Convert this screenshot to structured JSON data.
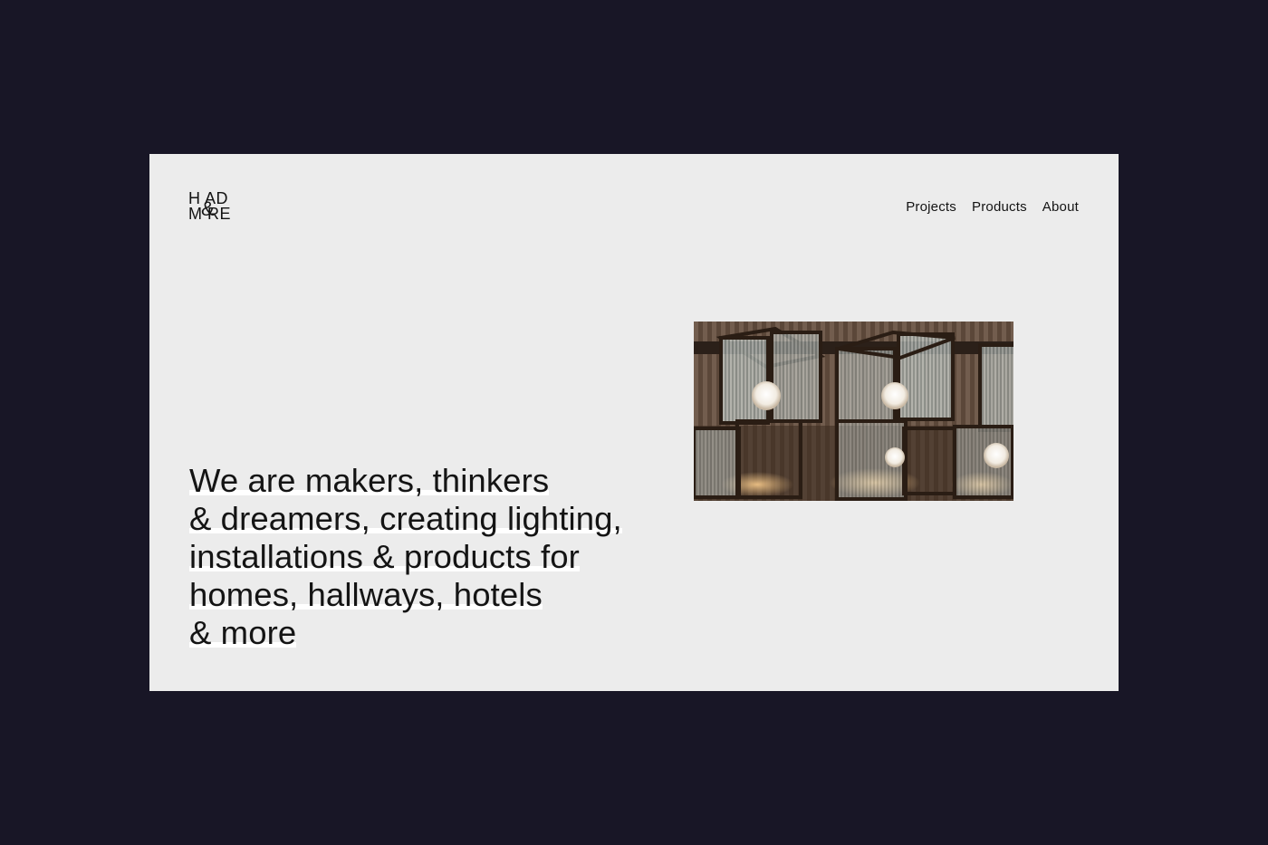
{
  "brand": {
    "logo_line1": "H AD",
    "logo_line2": "M RE",
    "logo_amp": "&",
    "logo_name": "Head & More"
  },
  "nav": [
    {
      "label": "Projects"
    },
    {
      "label": "Products"
    },
    {
      "label": "About"
    }
  ],
  "hero": {
    "lines": [
      "We are makers, thinkers",
      "& dreamers, creating lighting,",
      "installations & products for",
      "homes, hallways, hotels",
      "& more"
    ]
  },
  "image": {
    "subject": "pendant-lanterns-photo"
  },
  "colors": {
    "background": "#181626",
    "card": "#ececec",
    "text": "#141414"
  }
}
